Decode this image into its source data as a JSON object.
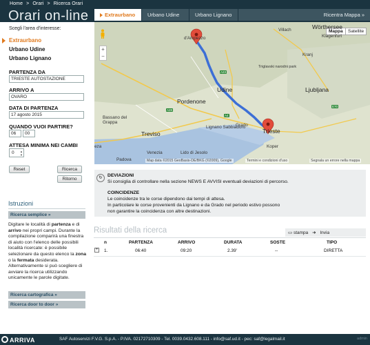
{
  "header": {
    "breadcrumb": [
      "Home",
      ">",
      "Orari",
      ">",
      "Ricerca Orari"
    ],
    "title": "Orari on-line"
  },
  "tabs": [
    {
      "label": "Extraurbano",
      "active": true
    },
    {
      "label": "Urbano Udine"
    },
    {
      "label": "Urbano Lignano"
    },
    {
      "label": "Ricentra Mappa »"
    }
  ],
  "left": {
    "choose_label": "Scegli l'area d'interesse:",
    "modes": [
      "Extraurbano",
      "Urbano Udine",
      "Urbano Lignano"
    ],
    "partenza_label": "PARTENZA DA",
    "partenza_value": "TRIESTE AUTOSTAZIONE",
    "arrivo_label": "ARRIVO A",
    "arrivo_value": "OVARO",
    "data_label": "DATA DI PARTENZA",
    "data_value": "17 agosto 2015",
    "quando_label": "QUANDO VUOI PARTIRE?",
    "ora": "06",
    "minuti": "00",
    "attesa_label": "ATTESA MINIMA NEI CAMBI",
    "attesa_value": "0",
    "reset_label": "Reset",
    "ricerca_label": "Ricerca",
    "ritorno_label": "Ritorno"
  },
  "istruzioni": {
    "title": "Istruzioni",
    "semplice_label": "Ricerca semplice »",
    "text_parts": [
      "Digitare le località di ",
      "partenza",
      " e di ",
      "arrivo",
      " nei propri campi. Durante la compilazione comparirà una finestra di aiuto con l'elenco delle possibili località ricercate: è possibile selezionare da questo elenco la ",
      "zona",
      " o la ",
      "fermata",
      " desiderata. Alternativamente si può scegliere di avviare la ricerca utilizzando unicamente le parole digitate."
    ],
    "cartografica_label": "Ricerca cartografica »",
    "door_label": "Ricerca door to door »"
  },
  "map": {
    "mappa_label": "Mappa",
    "satellite_label": "Satellite",
    "zoom_in": "+",
    "zoom_out": "−",
    "attribution": "Map data ©2015 GeoBasis-DE/BKG (©2009), Google",
    "terms": "Termini e condizioni d'uso",
    "report": "Segnala un errore nella mappa",
    "places": {
      "villach": "Villach",
      "worthersee": "Wörthersee",
      "klagenfurt": "Klagenfurt",
      "ampezzo": "d'Ampezzo",
      "kranj": "Kranj",
      "triglav": "Triglavski narodni park",
      "udine": "Udine",
      "ljubljana": "Ljubljana",
      "pordenone": "Pordenone",
      "bassano": "Bassano del Grappa",
      "treviso": "Treviso",
      "lignano": "Lignano Sabbiadoro",
      "grado": "Grado",
      "trieste": "Trieste",
      "koper": "Koper",
      "lido": "Lido di Jesolo",
      "venezia": "Venezia",
      "padova": "Padova",
      "eza": "eza"
    },
    "roads": {
      "a23": "A23",
      "a28": "A28",
      "a4": "A4",
      "e70": "E70"
    }
  },
  "notice": {
    "title1": "DEVIAZIONI",
    "text1": "Si consiglia di controllare nella sezione NEWS E AVVISI eventuali deviazioni di percorso.",
    "title2": "COINCIDENZE",
    "text2a": "Le coincidenze tra le corse dipendono dai tempi di attesa.",
    "text2b": "In particolare le corse provenienti da Lignano e da Grado nel periodo estivo possono",
    "text2c": "non garantire la coincidenza con altre destinazioni."
  },
  "results": {
    "title": "Risultati della ricerca",
    "stampa": "stampa",
    "invia": "Invia",
    "columns": [
      "n",
      "PARTENZA",
      "ARRIVO",
      "DURATA",
      "SOSTE",
      "TIPO"
    ],
    "rows": [
      {
        "n": "1.",
        "partenza": "06:40",
        "arrivo": "09:20",
        "durata": "2.39'",
        "soste": "--",
        "tipo": "DIRETTA"
      }
    ]
  },
  "footer": {
    "logo": "ARRIVA",
    "text": "SAF Autoservizi F.V.G. S.p.A. - P.IVA. 02172710309 - Tel. 0039.0432.608.111 - info@saf.ud.it - pec: saf@legalmail.it",
    "admin": "admin"
  },
  "colors": {
    "header_bg": "#1b3440",
    "accent": "#e07a1e",
    "route": "#3d6fd6"
  }
}
